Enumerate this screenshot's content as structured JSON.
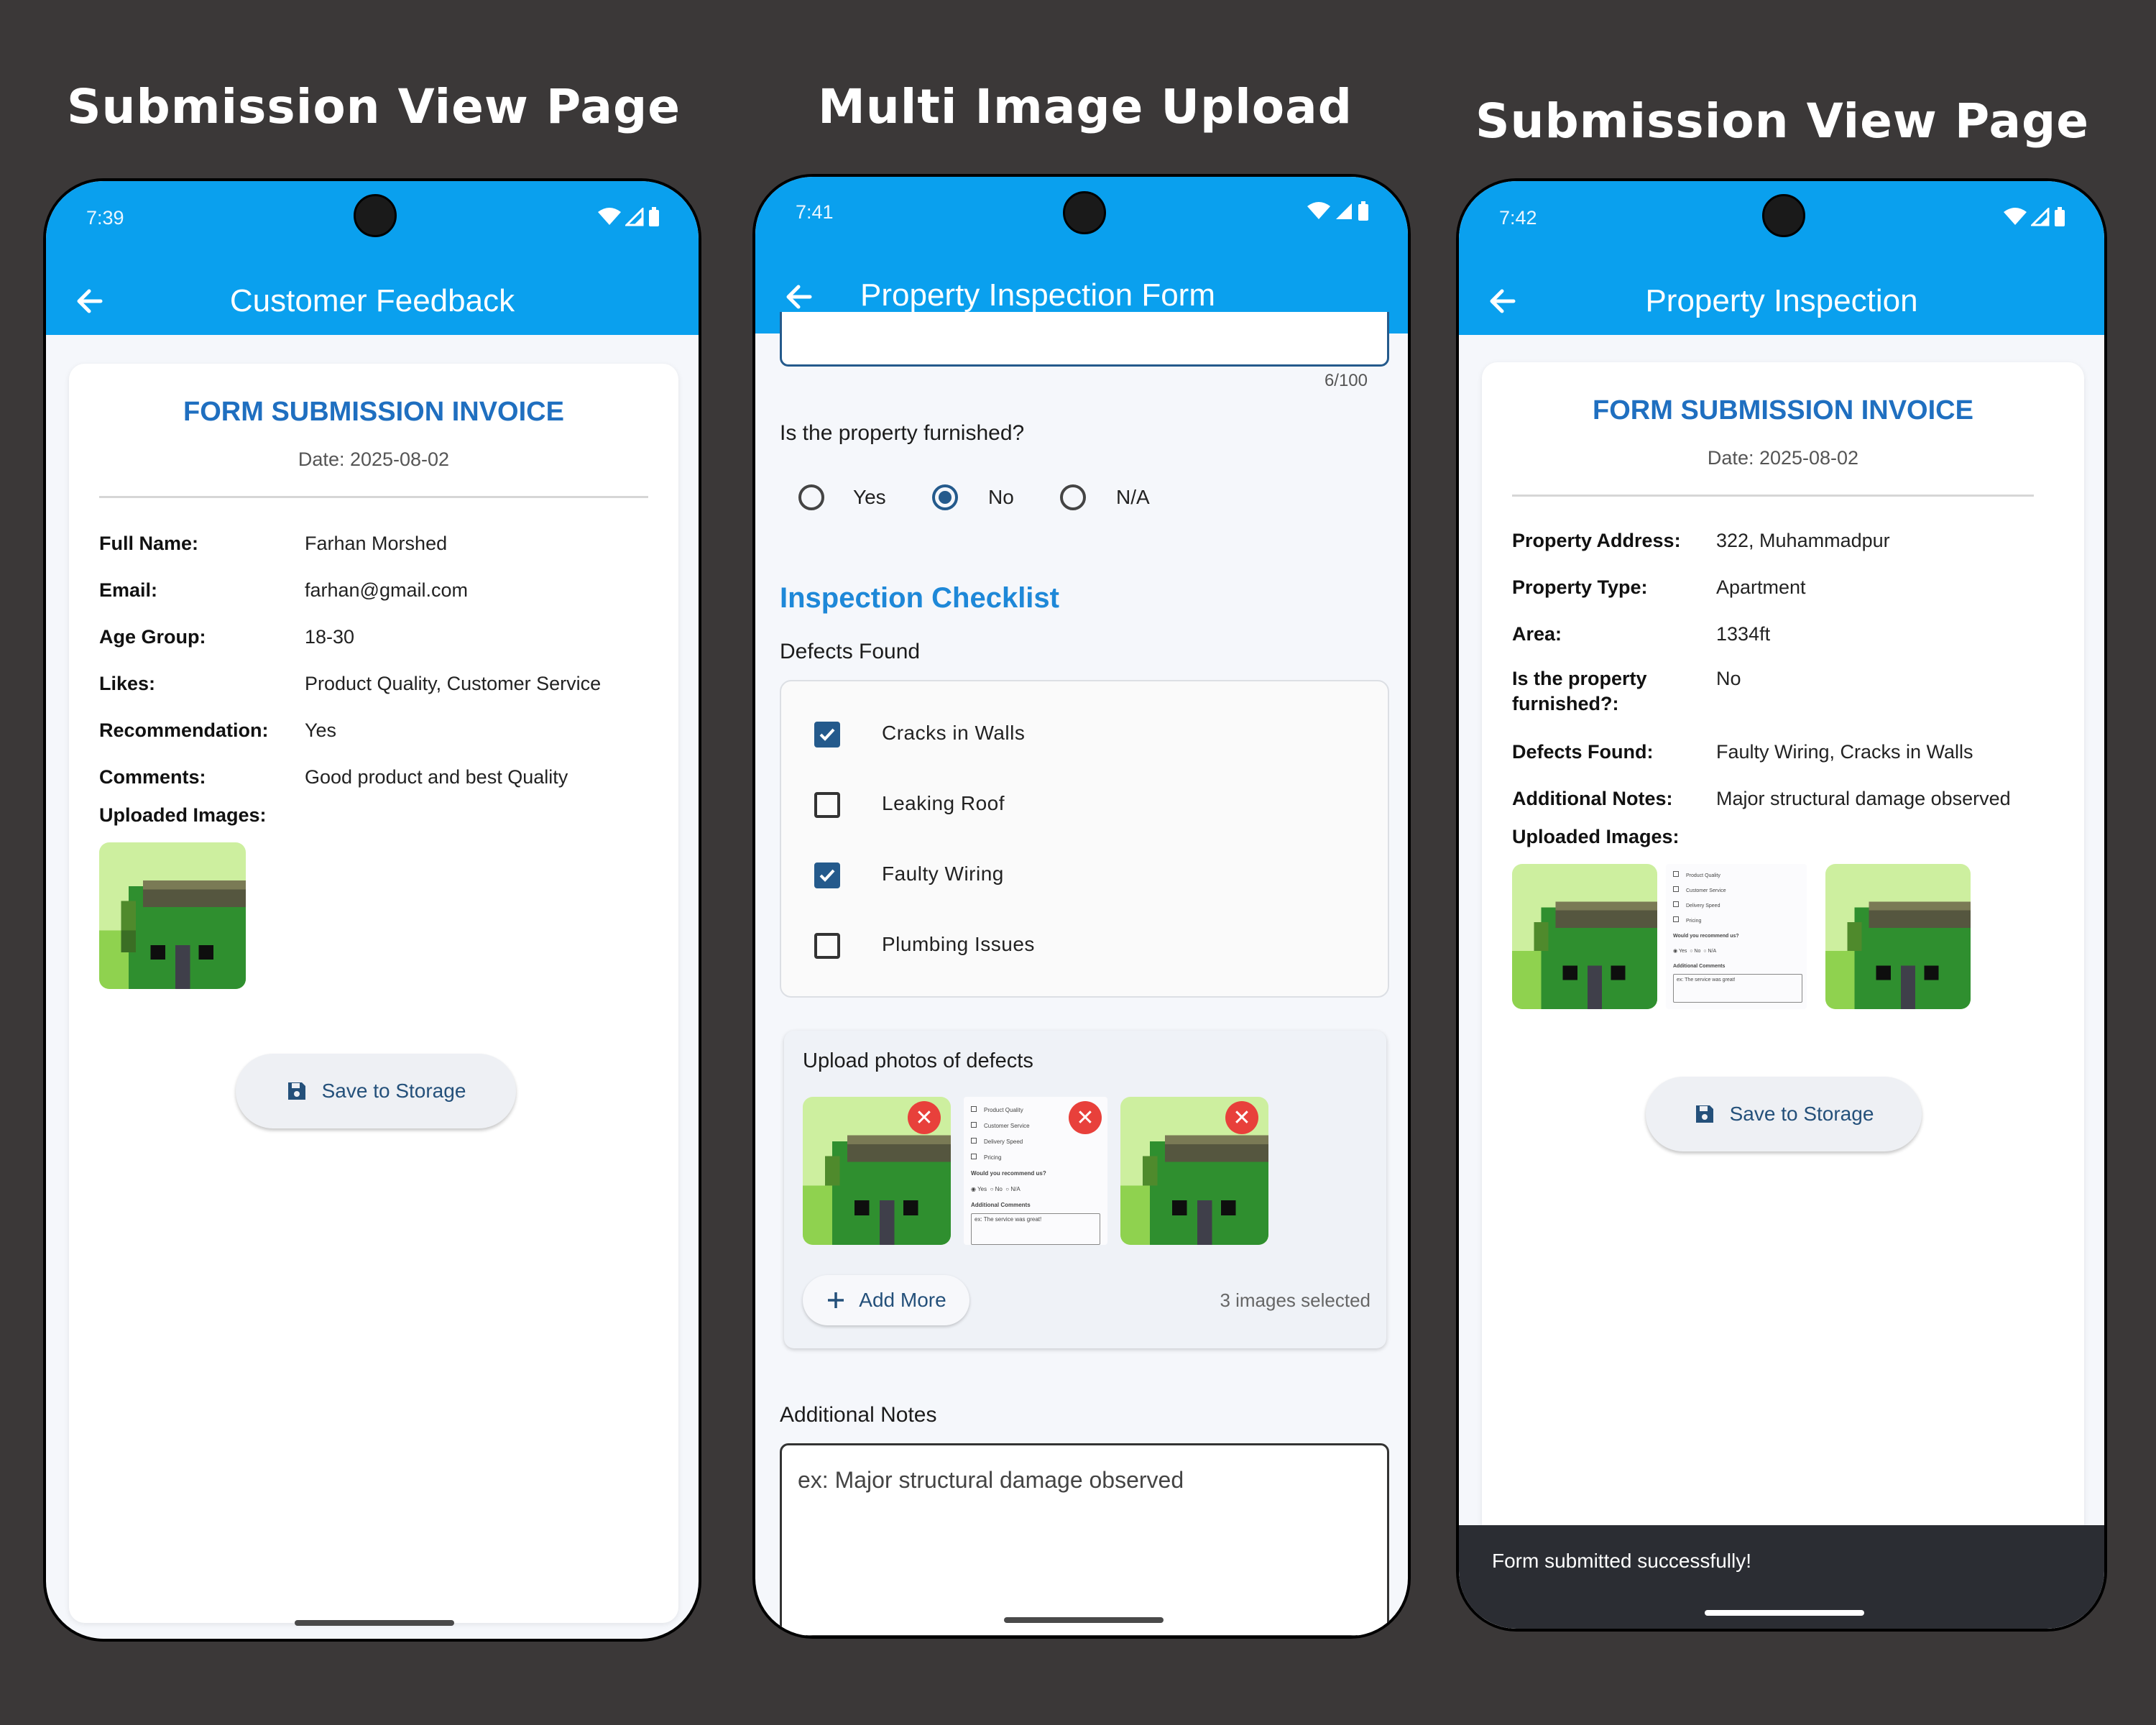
{
  "headings": [
    "Submission View Page",
    "Multi Image Upload",
    "Submission View Page"
  ],
  "phone1": {
    "time": "7:39",
    "title": "Customer Feedback",
    "invoice_title": "FORM SUBMISSION INVOICE",
    "date": "Date: 2025-08-02",
    "rows": [
      {
        "label": "Full Name:",
        "value": "Farhan Morshed"
      },
      {
        "label": "Email:",
        "value": "farhan@gmail.com"
      },
      {
        "label": "Age Group:",
        "value": "18-30"
      },
      {
        "label": "Likes:",
        "value": "Product Quality, Customer Service"
      },
      {
        "label": "Recommendation:",
        "value": "Yes"
      },
      {
        "label": "Comments:",
        "value": "Good product and best Quality"
      }
    ],
    "images_label": "Uploaded Images:",
    "save_label": "Save to Storage"
  },
  "phone2": {
    "time": "7:41",
    "title": "Property Inspection Form",
    "char_count": "6/100",
    "furnished_question": "Is the property furnished?",
    "furnished_options": [
      "Yes",
      "No",
      "N/A"
    ],
    "furnished_selected": "No",
    "checklist_heading": "Inspection Checklist",
    "defects_label": "Defects Found",
    "defects": [
      {
        "label": "Cracks in Walls",
        "checked": true
      },
      {
        "label": "Leaking Roof",
        "checked": false
      },
      {
        "label": "Faulty Wiring",
        "checked": true
      },
      {
        "label": "Plumbing Issues",
        "checked": false
      }
    ],
    "upload_label": "Upload photos of defects",
    "add_more_label": "Add More",
    "images_selected": "3 images selected",
    "notes_label": "Additional Notes",
    "notes_placeholder": "ex: Major structural damage observed"
  },
  "phone3": {
    "time": "7:42",
    "title": "Property Inspection",
    "invoice_title": "FORM SUBMISSION INVOICE",
    "date": "Date: 2025-08-02",
    "rows": [
      {
        "label": "Property Address:",
        "value": "322, Muhammadpur"
      },
      {
        "label": "Property Type:",
        "value": "Apartment"
      },
      {
        "label": "Area:",
        "value": "1334ft"
      },
      {
        "label_lines": [
          "Is the property",
          "furnished?:"
        ],
        "value": "No"
      },
      {
        "label": "Defects Found:",
        "value": "Faulty Wiring, Cracks in Walls"
      },
      {
        "label": "Additional Notes:",
        "value": "Major structural damage observed"
      }
    ],
    "images_label": "Uploaded Images:",
    "save_label": "Save to Storage",
    "snackbar": "Form submitted successfully!"
  },
  "mini_form": {
    "options": [
      "Product Quality",
      "Customer Service",
      "Delivery Speed",
      "Pricing"
    ],
    "question": "Would you recommend us?",
    "answers": [
      "Yes",
      "No",
      "N/A"
    ],
    "comments_label": "Additional Comments",
    "comments_placeholder": "ex: The service was great!"
  },
  "colors": {
    "appbar": "#0aa0ee",
    "accent_blue": "#1f6fc0",
    "checkbox_blue": "#245a8c",
    "remove_red": "#e8403b",
    "background": "#3b3838"
  },
  "icons": [
    "back-arrow-icon",
    "wifi-icon",
    "signal-icon",
    "battery-icon",
    "save-icon",
    "plus-icon",
    "close-icon"
  ]
}
